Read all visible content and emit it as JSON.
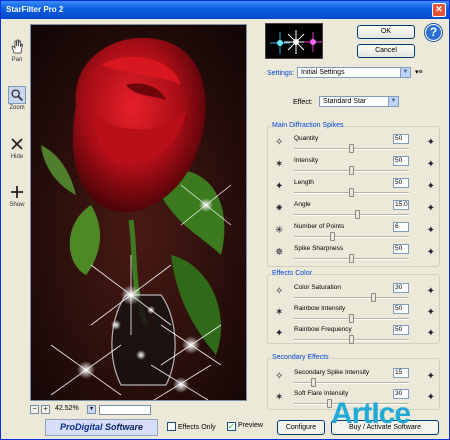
{
  "window": {
    "title": "StarFilter Pro 2",
    "close_glyph": "✕"
  },
  "tools": [
    {
      "label": "Pan",
      "icon": "hand-icon"
    },
    {
      "label": "Zoom",
      "icon": "magnifier-icon"
    },
    {
      "label": "Hide",
      "icon": "x-icon"
    },
    {
      "label": "Show",
      "icon": "plus-icon"
    }
  ],
  "preview_bar": {
    "minus": "−",
    "plus": "+",
    "zoom": "42.52%",
    "dropdown": "▾"
  },
  "bottom": {
    "logo_brand": "ProDigital",
    "logo_suffix": "Software",
    "effects_only": "Effects Only",
    "preview": "Preview",
    "preview_check": "✓",
    "configure": "Configure",
    "activate": "Buy / Activate Software"
  },
  "buttons": {
    "ok": "OK",
    "cancel": "Cancel",
    "help": "?"
  },
  "settings": {
    "label": "Settings:",
    "value": "Initial Settings",
    "extra": "▾≡"
  },
  "effect": {
    "label": "Effect:",
    "value": "Standard Star"
  },
  "main_group": {
    "title": "Main Diffraction Spikes",
    "params": [
      {
        "label": "Quantity",
        "value": "50",
        "fill": 0.5
      },
      {
        "label": "Intensity",
        "value": "50",
        "fill": 0.5
      },
      {
        "label": "Length",
        "value": "50",
        "fill": 0.5
      },
      {
        "label": "Angle",
        "value": "15.0",
        "fill": 0.55
      },
      {
        "label": "Number of Points",
        "value": "6",
        "fill": 0.33
      },
      {
        "label": "Spike Sharpness",
        "value": "50",
        "fill": 0.5
      }
    ]
  },
  "color_group": {
    "title": "Effects Color",
    "params": [
      {
        "label": "Color Saturation",
        "value": "30",
        "fill": 0.7
      },
      {
        "label": "Rainbow Intensity",
        "value": "50",
        "fill": 0.5
      },
      {
        "label": "Rainbow Frequency",
        "value": "50",
        "fill": 0.5
      }
    ]
  },
  "secondary_group": {
    "title": "Secondary Effects",
    "params": [
      {
        "label": "Secondary Spike Intensity",
        "value": "15",
        "fill": 0.15
      },
      {
        "label": "Soft Flare Intensity",
        "value": "30",
        "fill": 0.3
      }
    ]
  },
  "watermark": {
    "text": "ArtIce"
  },
  "colors": {
    "title_bar": "#0a5ee0",
    "accent": "#0046d5",
    "watermark": "#1faad8"
  }
}
